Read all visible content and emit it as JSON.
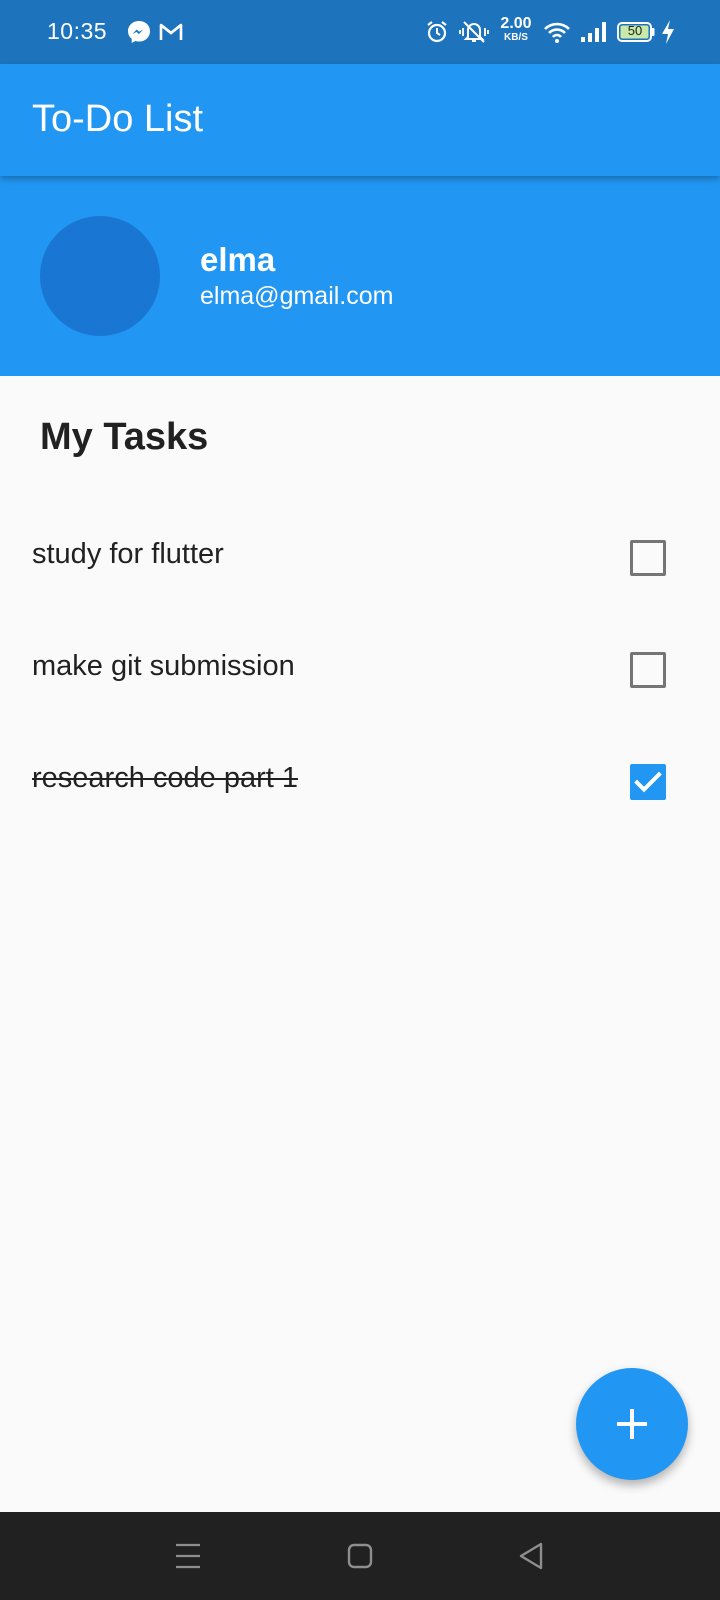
{
  "status_bar": {
    "time": "10:35",
    "net_speed_value": "2.00",
    "net_speed_unit": "KB/S",
    "battery_level": "50",
    "icons": [
      "messenger-icon",
      "gmail-icon",
      "alarm-icon",
      "vibrate-icon",
      "wifi-icon",
      "signal-icon",
      "battery-icon",
      "charging-icon"
    ]
  },
  "app_bar": {
    "title": "To-Do List"
  },
  "profile": {
    "name": "elma",
    "email": "elma@gmail.com"
  },
  "tasks_section": {
    "title": "My Tasks",
    "tasks": [
      {
        "label": "study for flutter",
        "checked": false
      },
      {
        "label": "make git submission",
        "checked": false
      },
      {
        "label": "research code part 1",
        "checked": true
      }
    ]
  },
  "fab": {
    "icon": "plus-icon"
  },
  "nav_bar": {
    "icons": [
      "menu-icon",
      "home-icon",
      "back-icon"
    ]
  },
  "colors": {
    "primary": "#2196f3",
    "primary_dark": "#1976d2",
    "status_bar": "#1d74bd",
    "background": "#fafafa",
    "nav_bar": "#212121"
  }
}
